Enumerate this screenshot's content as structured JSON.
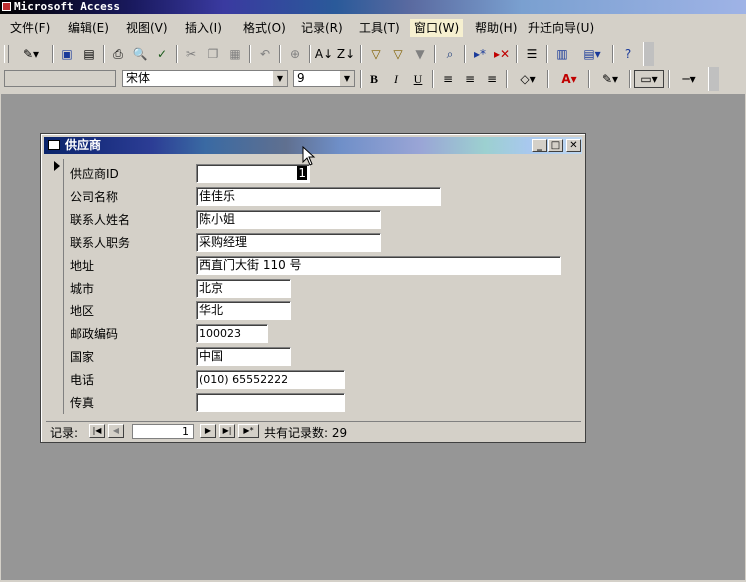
{
  "app": {
    "title": "Microsoft Access"
  },
  "menu": [
    "文件(F)",
    "编辑(E)",
    "视图(V)",
    "插入(I)",
    "格式(O)",
    "记录(R)",
    "工具(T)",
    "窗口(W)",
    "帮助(H)",
    "升迁向导(U)"
  ],
  "format_toolbar": {
    "object_select": "",
    "font_name": "宋体",
    "font_size": "9",
    "bold": "B",
    "italic": "I",
    "underline": "U"
  },
  "form": {
    "title": "供应商",
    "fields": [
      {
        "label": "供应商ID",
        "value": "1"
      },
      {
        "label": "公司名称",
        "value": "佳佳乐"
      },
      {
        "label": "联系人姓名",
        "value": "陈小姐"
      },
      {
        "label": "联系人职务",
        "value": "采购经理"
      },
      {
        "label": "地址",
        "value": "西直门大街 110 号"
      },
      {
        "label": "城市",
        "value": "北京"
      },
      {
        "label": "地区",
        "value": "华北"
      },
      {
        "label": "邮政编码",
        "value": "100023"
      },
      {
        "label": "国家",
        "value": "中国"
      },
      {
        "label": "电话",
        "value": "(010) 65552222"
      },
      {
        "label": "传真",
        "value": ""
      }
    ],
    "nav": {
      "label": "记录:",
      "current": "1",
      "count_text": "共有记录数: 29"
    }
  },
  "icons": [
    "design-icon",
    "save-icon",
    "print-icon",
    "preview-icon",
    "spell-icon",
    "cut-icon",
    "copy-icon",
    "paste-icon",
    "undo-icon",
    "hyperlink-icon",
    "sort-asc-icon",
    "sort-desc-icon",
    "filter-selection-icon",
    "filter-form-icon",
    "apply-filter-icon",
    "find-icon",
    "new-record-icon",
    "delete-record-icon",
    "properties-icon",
    "database-window-icon",
    "new-object-icon",
    "help-icon"
  ]
}
